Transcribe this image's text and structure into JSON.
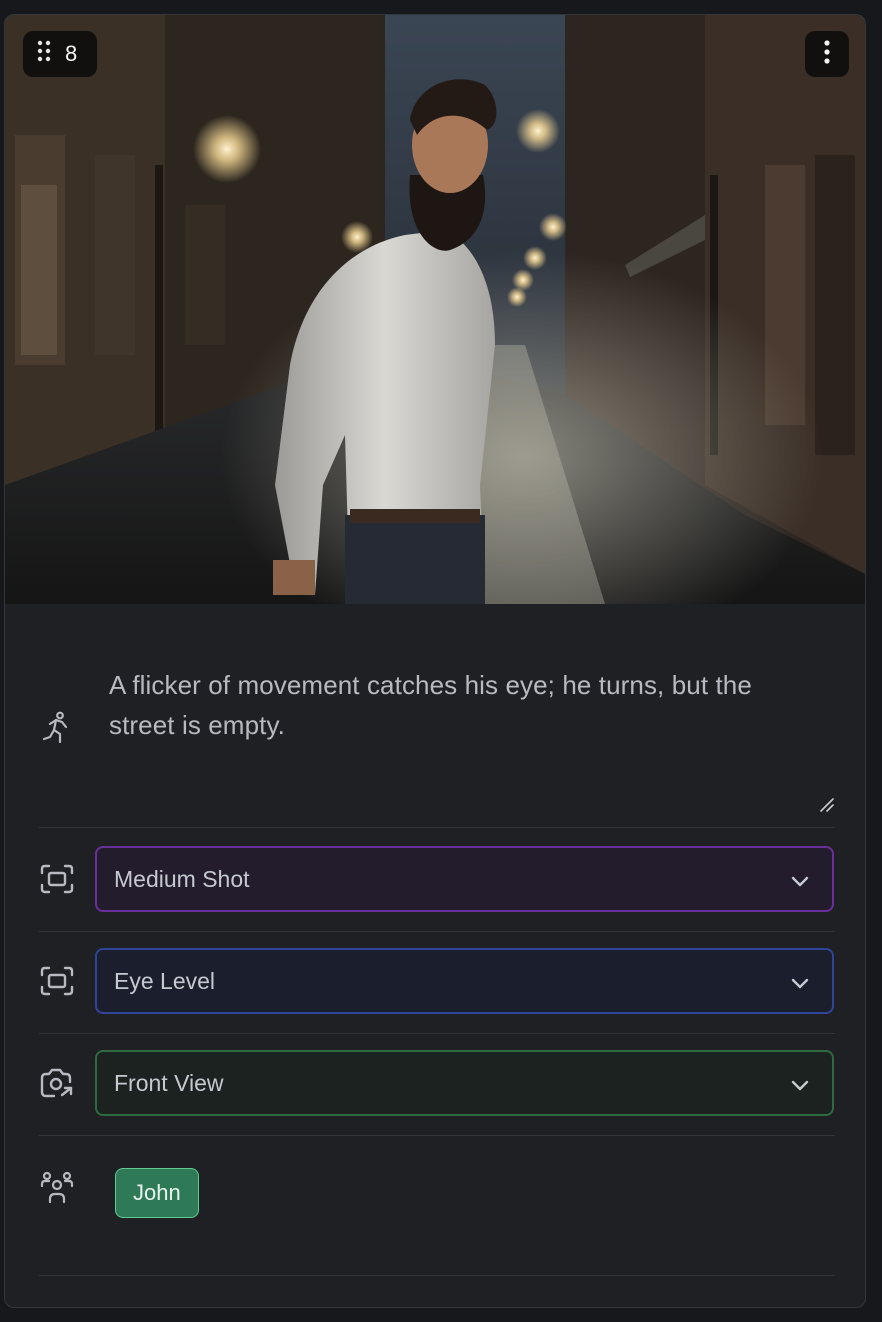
{
  "scene": {
    "number": "8",
    "image_alt": "Bearded man in a white shirt on a rainy night street, looking over his shoulder",
    "description": "A flicker of movement catches his eye; he turns, but the street is empty."
  },
  "icons": {
    "drag": "drag-handle-icon",
    "menu": "more-vertical-icon",
    "action": "running-person-icon",
    "shot": "frame-focus-icon",
    "angle": "frame-focus-icon",
    "view": "camera-rotate-icon",
    "characters": "people-group-icon"
  },
  "fields": {
    "shot_type": {
      "value": "Medium Shot",
      "border_color": "#6b2f9c"
    },
    "camera_angle": {
      "value": "Eye Level",
      "border_color": "#2f4599"
    },
    "camera_view": {
      "value": "Front View",
      "border_color": "#2d6a3f"
    }
  },
  "characters": [
    {
      "name": "John",
      "color": "#2f7a56"
    }
  ]
}
